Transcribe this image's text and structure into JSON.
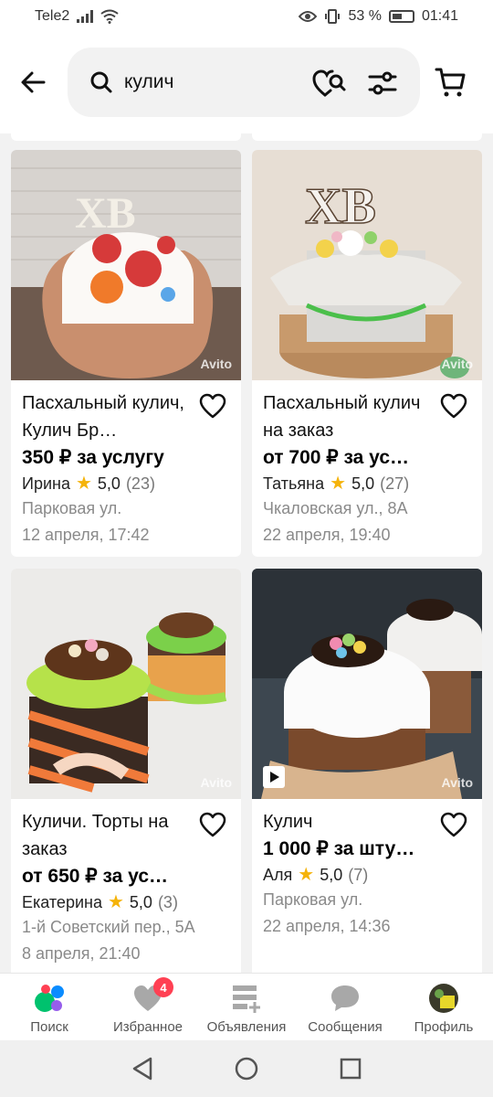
{
  "status_bar": {
    "carrier": "Tele2",
    "battery_percent": "53 %",
    "time": "01:41"
  },
  "search": {
    "query": "кулич"
  },
  "listings": [
    {
      "title": "Пасхальный кулич, Кулич Бр…",
      "price": "350 ₽ за услугу",
      "seller": "Ирина",
      "rating": "5,0",
      "reviews": "(23)",
      "address": "Парковая ул.",
      "date": "12 апреля, 17:42",
      "watermark": "Avito"
    },
    {
      "title": "Пасхальный кулич на заказ",
      "price": "от 700 ₽ за ус…",
      "seller": "Татьяна",
      "rating": "5,0",
      "reviews": "(27)",
      "address": "Чкаловская ул., 8А",
      "date": "22 апреля, 19:40",
      "watermark": "Avito"
    },
    {
      "title": "Куличи. Торты на заказ",
      "price": "от 650 ₽ за ус…",
      "seller": "Екатерина",
      "rating": "5,0",
      "reviews": "(3)",
      "address": "1-й Советский пер., 5А",
      "date": "8 апреля, 21:40",
      "watermark": "Avito"
    },
    {
      "title": "Кулич",
      "price": "1 000 ₽ за шту…",
      "seller": "Аля",
      "rating": "5,0",
      "reviews": "(7)",
      "address": "Парковая ул.",
      "date": "22 апреля, 14:36",
      "watermark": "Avito"
    }
  ],
  "bottom_nav": {
    "items": [
      {
        "label": "Поиск",
        "icon": "search-dots-icon"
      },
      {
        "label": "Избранное",
        "icon": "heart-icon",
        "badge": "4"
      },
      {
        "label": "Объявления",
        "icon": "listings-add-icon"
      },
      {
        "label": "Сообщения",
        "icon": "chat-bubble-icon"
      },
      {
        "label": "Профиль",
        "icon": "avatar"
      }
    ]
  },
  "colors": {
    "accent_star": "#f5b30a",
    "badge": "#ff4053",
    "search_bg": "#f2f2f2"
  }
}
